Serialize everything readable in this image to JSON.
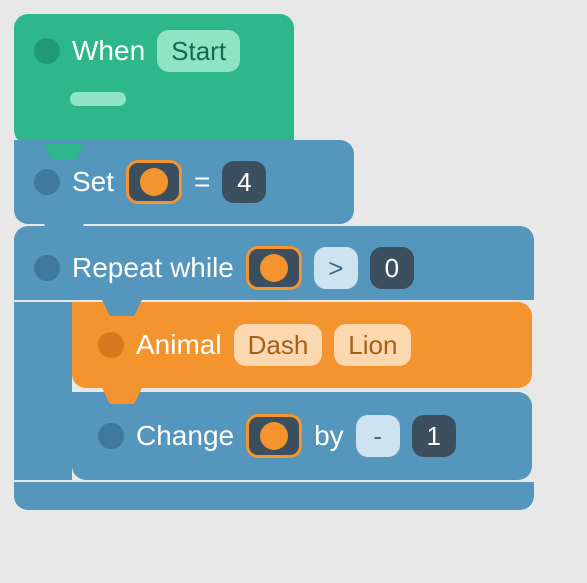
{
  "when": {
    "label": "When",
    "event": "Start"
  },
  "set": {
    "label": "Set",
    "eq": "=",
    "value": "4"
  },
  "repeat": {
    "label": "Repeat while",
    "op": ">",
    "rhs": "0"
  },
  "animal": {
    "label": "Animal",
    "target": "Dash",
    "kind": "Lion"
  },
  "change": {
    "label": "Change",
    "by": "by",
    "sign": "-",
    "amount": "1"
  }
}
